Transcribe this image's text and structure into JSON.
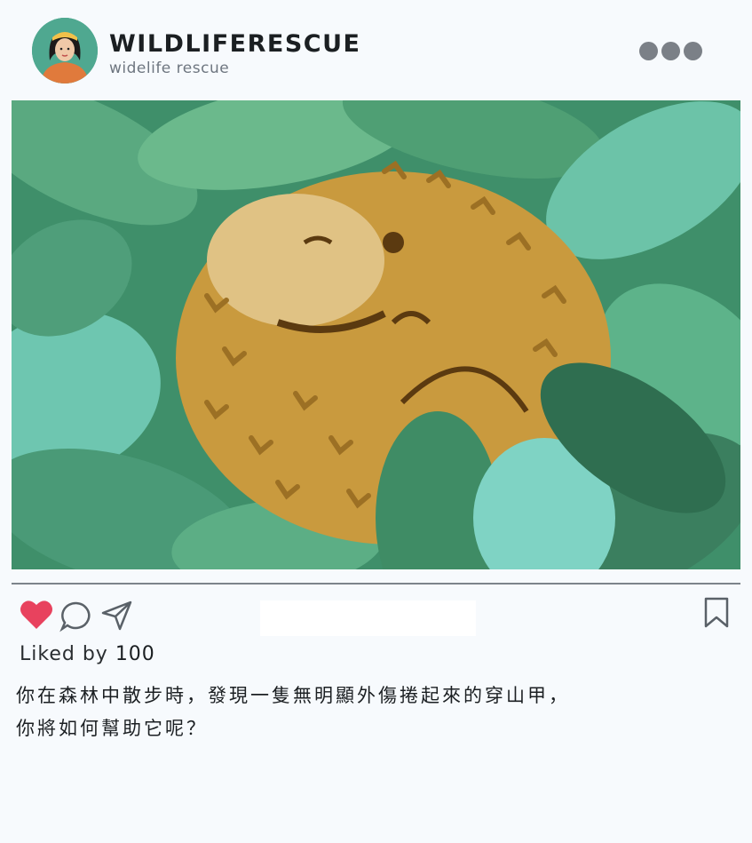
{
  "post": {
    "username": "WILDLIFERESCUE",
    "subname": "widelife rescue",
    "liked_prefix": "Liked by",
    "liked_count": "100",
    "caption_lines": [
      "你在森林中散步時，發現一隻無明顯外傷捲起來的穿山甲，",
      "你將如何幫助它呢？"
    ]
  },
  "icons": {
    "more": "more-options-icon",
    "like": "heart-icon",
    "comment": "comment-icon",
    "share": "send-icon",
    "save": "bookmark-icon"
  },
  "colors": {
    "heart": "#e8425e",
    "icon_stroke": "#5a6168",
    "background": "#f7fafd"
  }
}
